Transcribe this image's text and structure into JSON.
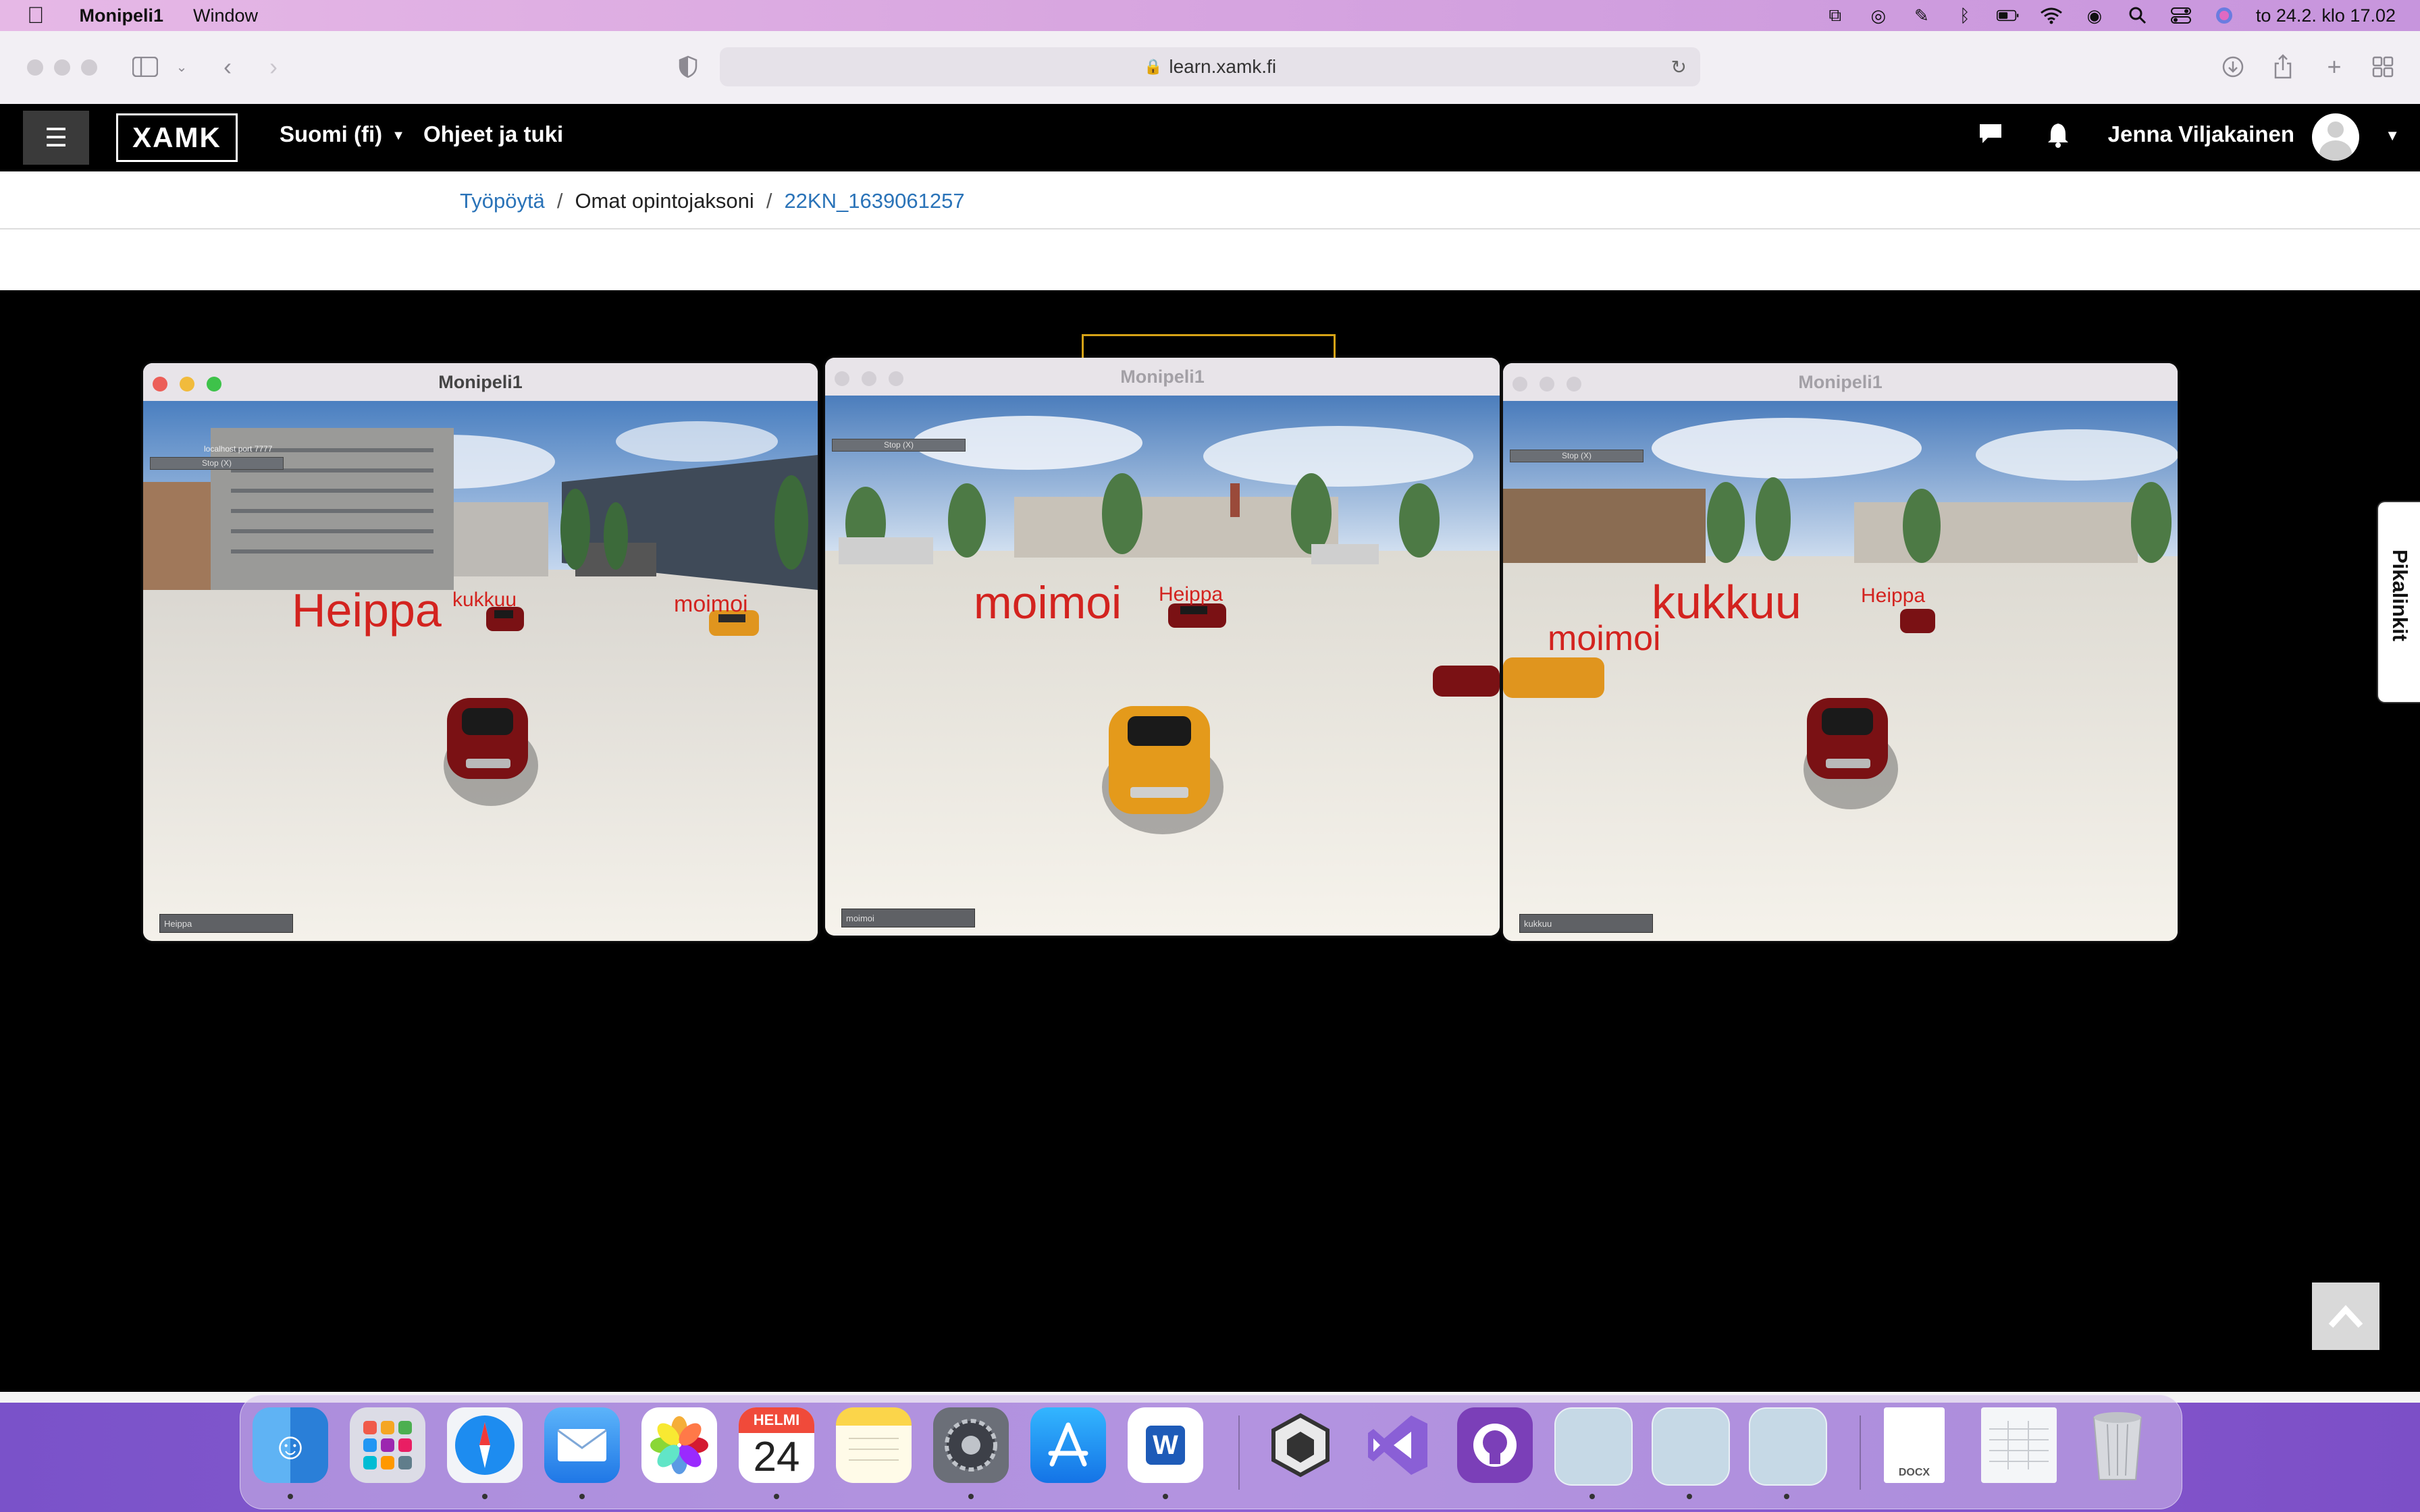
{
  "menubar": {
    "app_name": "Monipeli1",
    "menu_items": [
      "Window"
    ],
    "clock": "to 24.2. klo 17.02",
    "status_icons": [
      "airplay-icon",
      "creative-cloud-icon",
      "tool-icon",
      "bluetooth-icon",
      "battery-icon",
      "wifi-icon",
      "user-icon",
      "spotlight-search-icon",
      "control-center-icon",
      "siri-icon"
    ]
  },
  "browser": {
    "url": "learn.xamk.fi"
  },
  "navbar": {
    "logo": "XAMK",
    "language": "Suomi (fi)",
    "help": "Ohjeet ja tuki",
    "user_name": "Jenna Viljakainen"
  },
  "breadcrumb": {
    "items": [
      "Työpöytä",
      "Omat opintojaksoni",
      "22KN_1639061257"
    ]
  },
  "game_windows": [
    {
      "title": "Monipeli1",
      "hud_line1": "localhost port 7777",
      "hud_button": "Stop (X)",
      "input_value": "Heippa",
      "labels": [
        "Heippa",
        "kukkuu",
        "moimoi"
      ]
    },
    {
      "title": "Monipeli1",
      "hud_button": "Stop (X)",
      "input_value": "moimoi",
      "labels": [
        "moimoi",
        "Heippa"
      ]
    },
    {
      "title": "Monipeli1",
      "hud_button": "Stop (X)",
      "input_value": "kukkuu",
      "labels": [
        "kukkuu",
        "moimoi",
        "Heippa"
      ]
    }
  ],
  "sidebar_tab": "Pikalinkit",
  "dock": {
    "apps": [
      "Finder",
      "Launchpad",
      "Safari",
      "Mail",
      "Photos",
      "Calendar",
      "Notes",
      "System Preferences",
      "App Store",
      "Word",
      "Unity",
      "Visual Studio",
      "GitHub Desktop",
      "Window 1",
      "Window 2",
      "Window 3",
      "Document",
      "Spreadsheet",
      "Trash"
    ],
    "calendar_month": "HELMI",
    "calendar_day": "24",
    "word_letter": "W",
    "doc_label": "DOCX"
  },
  "colors": {
    "label_red": "#d3231f",
    "navbar": "#000000",
    "link_blue": "#2a73b8",
    "video_marker": "#d6a316"
  }
}
